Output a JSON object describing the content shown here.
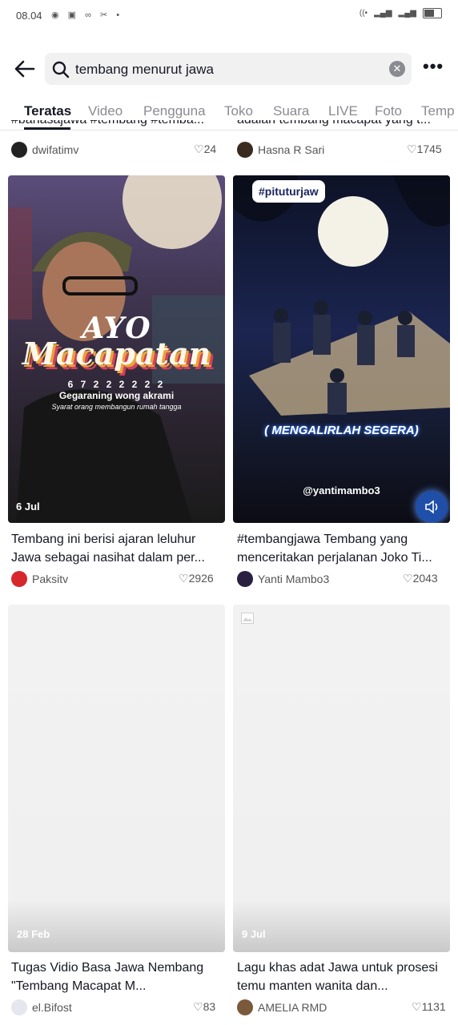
{
  "status_bar": {
    "time": "08.04"
  },
  "search": {
    "query": "tembang menurut jawa"
  },
  "tabs": [
    "Teratas",
    "Video",
    "Pengguna",
    "Toko",
    "Suara",
    "LIVE",
    "Foto",
    "Temp"
  ],
  "top_row": [
    {
      "title": "#bahasajawa #tembang #temba...",
      "user": "dwifatimv",
      "likes": "24"
    },
    {
      "title": "adalah tembang macapat yang t...",
      "user": "Hasna R Sari",
      "likes": "1745"
    }
  ],
  "middle_row": [
    {
      "date": "6 Jul",
      "overlay_title_1": "AYO",
      "overlay_title_2": "Macapatan",
      "overlay_numbers": "6 7 2 2 2    2 2 2",
      "overlay_sub": "Gegaraning wong akrami",
      "overlay_sub2": "Syarat orang membangun rumah tangga",
      "caption": "Tembang ini berisi ajaran leluhur Jawa sebagai nasihat dalam per...",
      "user": "Paksitv",
      "likes": "2926"
    },
    {
      "hashtag_tag": "#pituturjaw",
      "banner": "( MENGALIRLAH SEGERA)",
      "handle": "@yantimambo3",
      "caption": "#tembangjawa  Tembang yang menceritakan perjalanan Joko Ti...",
      "user": "Yanti Mambo3",
      "likes": "2043"
    }
  ],
  "bottom_row": [
    {
      "date": "28 Feb",
      "caption": "Tugas Vidio Basa Jawa Nembang \"Tembang Macapat M...",
      "user": "el.Bifost",
      "likes": "83"
    },
    {
      "date": "9 Jul",
      "caption": "Lagu khas adat Jawa untuk prosesi temu manten wanita dan...",
      "user": "AMELIA RMD",
      "likes": "1131"
    }
  ]
}
